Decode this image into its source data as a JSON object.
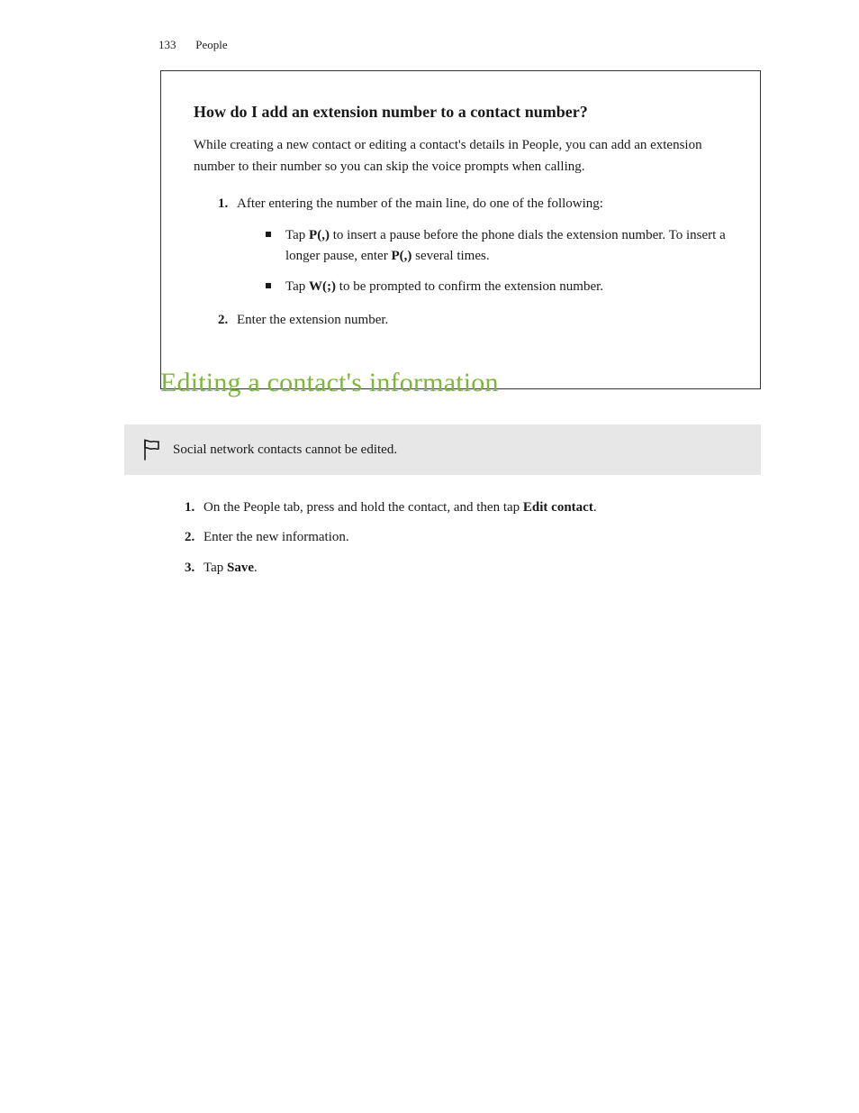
{
  "header": {
    "page_number": "133",
    "section_name": "People"
  },
  "faq_box": {
    "title": "How do I add an extension number to a contact number?",
    "intro": "While creating a new contact or editing a contact's details in People, you can add an extension number to their number so you can skip the voice prompts when calling.",
    "step1_text": "After entering the number of the main line, do one of the following:",
    "bullet1_a": "Tap ",
    "bullet1_b": "P(,)",
    "bullet1_c": " to insert a pause before the phone dials the extension number. To insert a longer pause, enter ",
    "bullet1_d": "P(,)",
    "bullet1_e": " several times.",
    "bullet2_a": "Tap ",
    "bullet2_b": "W(;)",
    "bullet2_c": " to be prompted to confirm the extension number.",
    "step2_text": "Enter the extension number."
  },
  "section_heading": "Editing a contact's information",
  "note": {
    "text": "Social network contacts cannot be edited."
  },
  "edit_steps": {
    "s1_a": "On the People tab, press and hold the contact, and then tap ",
    "s1_b": "Edit contact",
    "s1_c": ".",
    "s2": "Enter the new information.",
    "s3_a": "Tap ",
    "s3_b": "Save",
    "s3_c": "."
  }
}
